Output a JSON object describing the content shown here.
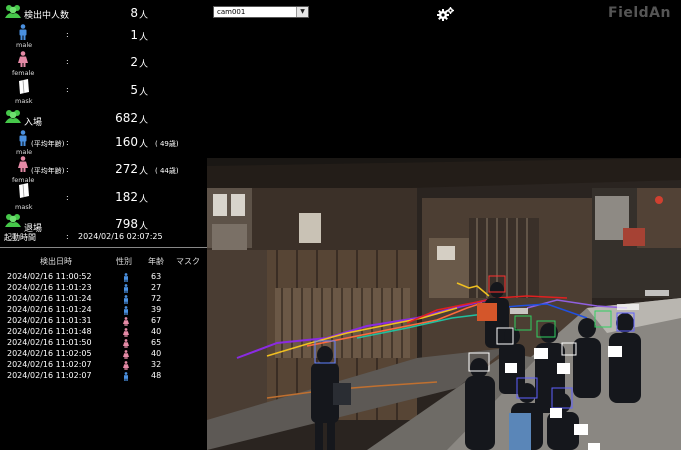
{
  "stats": {
    "detecting": {
      "label": "検出中人数",
      "value": "8",
      "unit": "人"
    },
    "male": {
      "label": "male",
      "colon": ":",
      "value": "1",
      "unit": "人"
    },
    "female": {
      "label": "female",
      "colon": ":",
      "value": "2",
      "unit": "人"
    },
    "mask": {
      "label": "mask",
      "colon": ":",
      "value": "5",
      "unit": "人"
    },
    "entry": {
      "label": "入場",
      "value": "682",
      "unit": "人"
    },
    "entry_male": {
      "label": "male",
      "avg_label": "(平均年齢)",
      "colon": ":",
      "value": "160",
      "unit": "人",
      "age": "( 49歳)"
    },
    "entry_female": {
      "label": "female",
      "avg_label": "(平均年齢)",
      "colon": ":",
      "value": "272",
      "unit": "人",
      "age": "( 44歳)"
    },
    "entry_mask": {
      "label": "mask",
      "colon": ":",
      "value": "182",
      "unit": "人"
    },
    "exit": {
      "label": "退場",
      "value": "798",
      "unit": "人"
    },
    "boot": {
      "label": "起動時間",
      "colon": ":",
      "value": "2024/02/16 02:07:25"
    }
  },
  "log": {
    "headers": {
      "time": "検出日時",
      "gender": "性別",
      "age": "年齢",
      "mask": "マスク"
    },
    "rows": [
      {
        "time": "2024/02/16 11:00:52",
        "gender": "male",
        "age": "63"
      },
      {
        "time": "2024/02/16 11:01:23",
        "gender": "male",
        "age": "27"
      },
      {
        "time": "2024/02/16 11:01:24",
        "gender": "male",
        "age": "72"
      },
      {
        "time": "2024/02/16 11:01:24",
        "gender": "male",
        "age": "39"
      },
      {
        "time": "2024/02/16 11:01:31",
        "gender": "female",
        "age": "67"
      },
      {
        "time": "2024/02/16 11:01:48",
        "gender": "female",
        "age": "40"
      },
      {
        "time": "2024/02/16 11:01:50",
        "gender": "female",
        "age": "65"
      },
      {
        "time": "2024/02/16 11:02:05",
        "gender": "female",
        "age": "40"
      },
      {
        "time": "2024/02/16 11:02:07",
        "gender": "female",
        "age": "32"
      },
      {
        "time": "2024/02/16 11:02:07",
        "gender": "male",
        "age": "48"
      }
    ]
  },
  "camera": {
    "selected": "cam001",
    "arrow": "▼"
  },
  "settings_icon": "gear-icon",
  "brand": "FieldAn",
  "colors": {
    "group": "#46c84a",
    "male": "#4a90e0",
    "female": "#e58aa6",
    "panel_bg": "#000000",
    "brand": "#555555"
  }
}
